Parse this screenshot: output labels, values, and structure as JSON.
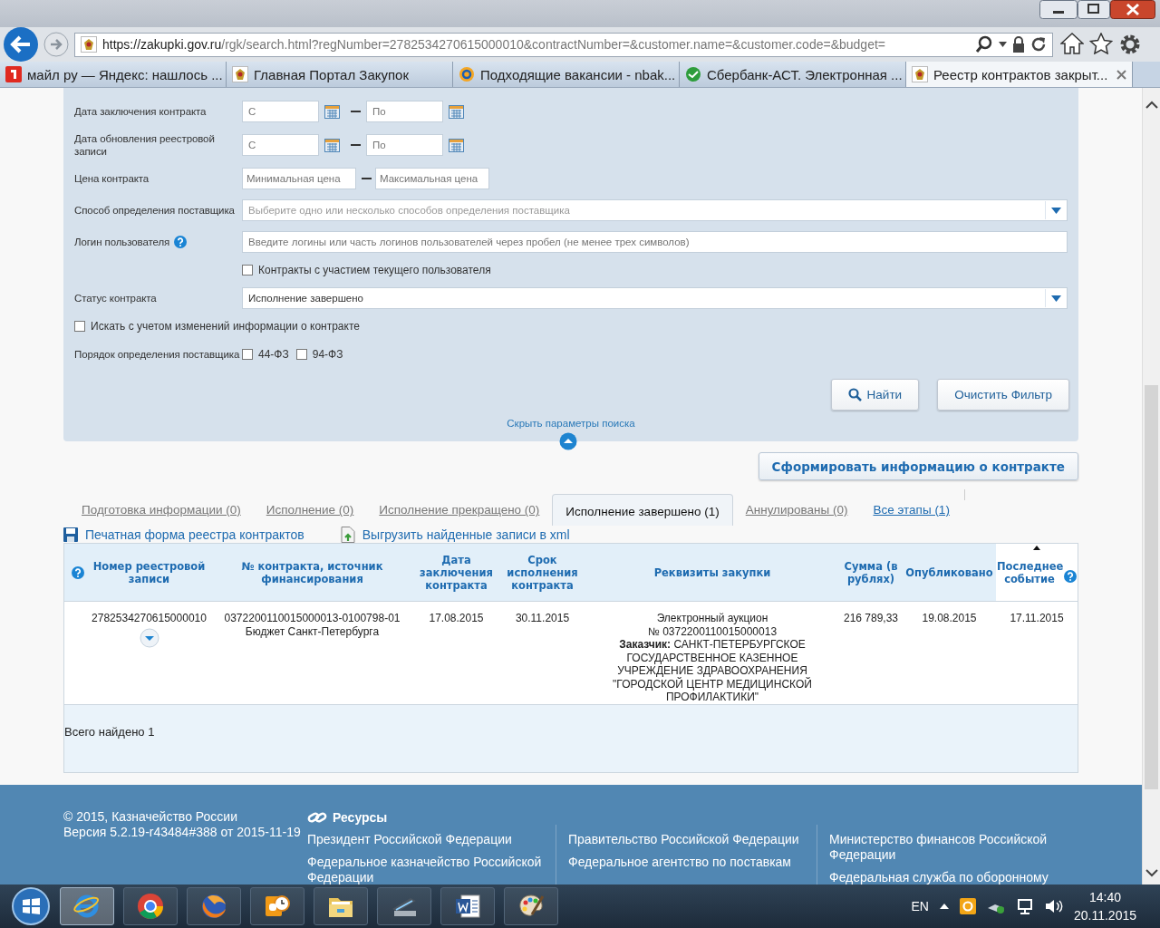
{
  "browser": {
    "address": {
      "host": "https://zakupki.gov.ru",
      "path": "/rgk/search.html?regNumber=2782534270615000010&contractNumber=&customer.name=&customer.code=&budget="
    },
    "tabs": [
      {
        "title": "майл ру — Яндекс: нашлось ...",
        "kind": "square",
        "selected": false
      },
      {
        "title": "Главная Портал Закупок",
        "kind": "emblem",
        "selected": false
      },
      {
        "title": "Подходящие вакансии - nbak...",
        "kind": "ring",
        "selected": false
      },
      {
        "title": "Сбербанк-АСТ. Электронная ...",
        "kind": "check",
        "selected": false
      },
      {
        "title": "Реестр контрактов закрыт...",
        "kind": "emblem",
        "selected": true
      }
    ]
  },
  "filter": {
    "rows": [
      {
        "kind": "date_range",
        "label": "Дата заключения контракта",
        "from_placeholder": "С",
        "to_placeholder": "По"
      },
      {
        "kind": "date_range",
        "label": "Дата обновления реестровой записи",
        "from_placeholder": "С",
        "to_placeholder": "По"
      },
      {
        "kind": "range",
        "label": "Цена контракта",
        "from_placeholder": "Минимальная цена",
        "to_placeholder": "Максимальная цена"
      },
      {
        "kind": "select",
        "label": "Способ определения поставщика",
        "placeholder": "Выберите одно или несколько способов определения поставщика"
      },
      {
        "kind": "text",
        "label": "Логин пользователя",
        "help": true,
        "placeholder": "Введите логины или часть логинов пользователей через пробел (не менее трех символов)"
      },
      {
        "kind": "sub_checkbox",
        "label": "Контракты с участием текущего пользователя",
        "checked": false
      },
      {
        "kind": "select",
        "label": "Статус контракта",
        "value": "Исполнение завершено"
      },
      {
        "kind": "checkbox",
        "label": "Искать с учетом изменений информации о контракте",
        "checked": false
      },
      {
        "kind": "checkboxes",
        "label": "Порядок определения поставщика",
        "options": [
          {
            "label": "44-ФЗ",
            "checked": false
          },
          {
            "label": "94-ФЗ",
            "checked": false
          }
        ]
      }
    ],
    "find_button": "Найти",
    "clear_button": "Очистить Фильтр",
    "hide_link": "Скрыть параметры поиска"
  },
  "action_button": "Сформировать информацию о контракте",
  "result_tabs": [
    {
      "label": "Подготовка информации (0)",
      "selected": false,
      "disabled": true
    },
    {
      "label": "Исполнение (0)",
      "selected": false,
      "disabled": true
    },
    {
      "label": "Исполнение прекращено (0)",
      "selected": false,
      "disabled": true
    },
    {
      "label": "Исполнение завершено (1)",
      "selected": true,
      "disabled": false
    },
    {
      "label": "Аннулированы (0)",
      "selected": false,
      "disabled": true
    },
    {
      "label": "Все этапы (1)",
      "selected": false,
      "disabled": false
    }
  ],
  "links": [
    {
      "kind": "print",
      "label": "Печатная форма реестра контрактов"
    },
    {
      "kind": "export",
      "label": "Выгрузить найденные записи в xml"
    }
  ],
  "table": {
    "help_icon": true,
    "columns": [
      {
        "label": "Номер реестровой записи"
      },
      {
        "label": "№ контракта, источник финансирования"
      },
      {
        "label": "Дата заключения контракта"
      },
      {
        "label": "Срок исполнения контракта"
      },
      {
        "label": "Реквизиты закупки"
      },
      {
        "label": "Сумма (в рублях)"
      },
      {
        "label": "Опубликовано"
      },
      {
        "label": "Последнее событие",
        "help": true,
        "sorted": true
      }
    ],
    "rows": [
      {
        "expandable": true,
        "cells": [
          [
            "2782534270615000010"
          ],
          [
            "0372200110015000013-0100798-01",
            "Бюджет Санкт-Петербурга"
          ],
          [
            "17.08.2015"
          ],
          [
            "30.11.2015"
          ],
          [
            "Электронный аукцион",
            "№ 0372200110015000013",
            "**Заказчик:** САНКТ-ПЕТЕРБУРГСКОЕ ГОСУДАРСТВЕННОЕ КАЗЕННОЕ УЧРЕЖДЕНИЕ ЗДРАВООХРАНЕНИЯ \"ГОРОДСКОЙ ЦЕНТР МЕДИЦИНСКОЙ ПРОФИЛАКТИКИ\""
          ],
          [
            "216 789,33"
          ],
          [
            "19.08.2015"
          ],
          [
            "17.11.2015"
          ]
        ]
      }
    ],
    "total": "Всего найдено 1"
  },
  "footer": {
    "copyright": "© 2015, Казначейство России",
    "version": "Версия 5.2.19-r43484#388 от 2015-11-19",
    "resources_title": "Ресурсы",
    "columns": [
      [
        "Президент Российской Федерации",
        "Федеральное казначейство Российской Федерации"
      ],
      [
        "Правительство Российской Федерации",
        "Федеральное агентство по поставкам"
      ],
      [
        "Министерство финансов Российской Федерации",
        "Федеральная служба по оборонному"
      ]
    ]
  },
  "taskbar": {
    "apps": [
      {
        "kind": "ie",
        "active": true
      },
      {
        "kind": "chrome",
        "active": false
      },
      {
        "kind": "firefox",
        "active": false
      },
      {
        "kind": "outlook",
        "active": false
      },
      {
        "kind": "folder",
        "active": false
      },
      {
        "kind": "scanner",
        "active": false
      },
      {
        "kind": "word",
        "active": false
      },
      {
        "kind": "paint",
        "active": false
      }
    ],
    "language": "EN",
    "time": "14:40",
    "date": "20.11.2015"
  }
}
